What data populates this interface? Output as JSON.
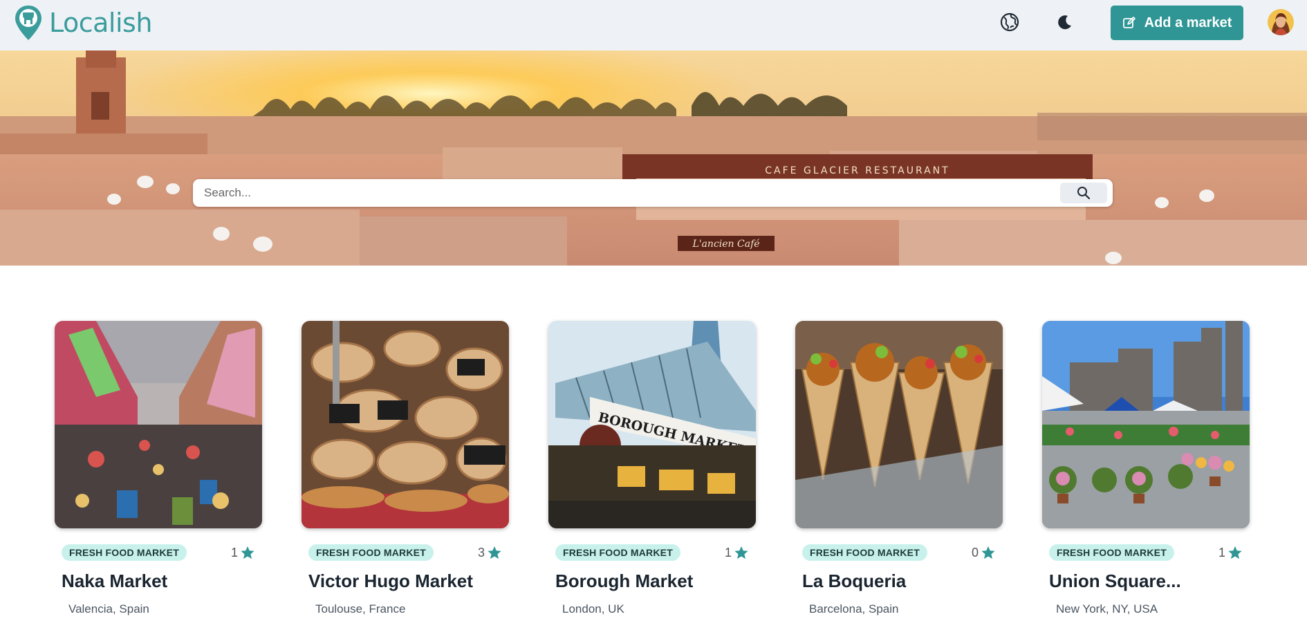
{
  "header": {
    "logo_text": "Localish",
    "add_button_label": "Add a market",
    "accent_color": "#2f9695",
    "icons": [
      "globe-icon",
      "moon-icon",
      "edit-icon"
    ]
  },
  "search": {
    "placeholder": "Search...",
    "value": ""
  },
  "markets": [
    {
      "category": "FRESH FOOD MARKET",
      "rating": "1",
      "name": "Naka Market",
      "location": "Valencia, Spain"
    },
    {
      "category": "FRESH FOOD MARKET",
      "rating": "3",
      "name": "Victor Hugo Market",
      "location": "Toulouse, France"
    },
    {
      "category": "FRESH FOOD MARKET",
      "rating": "1",
      "name": "Borough Market",
      "location": "London, UK"
    },
    {
      "category": "FRESH FOOD MARKET",
      "rating": "0",
      "name": "La Boqueria",
      "location": "Barcelona, Spain"
    },
    {
      "category": "FRESH FOOD MARKET",
      "rating": "1",
      "name": "Union Square...",
      "location": "New York, NY, USA"
    }
  ],
  "market_image_signs": {
    "borough": "BOROUGH MARKET"
  },
  "hero_signs": {
    "restaurant": "CAFE GLACIER RESTAURANT",
    "cafe": "L'ancien Café"
  }
}
